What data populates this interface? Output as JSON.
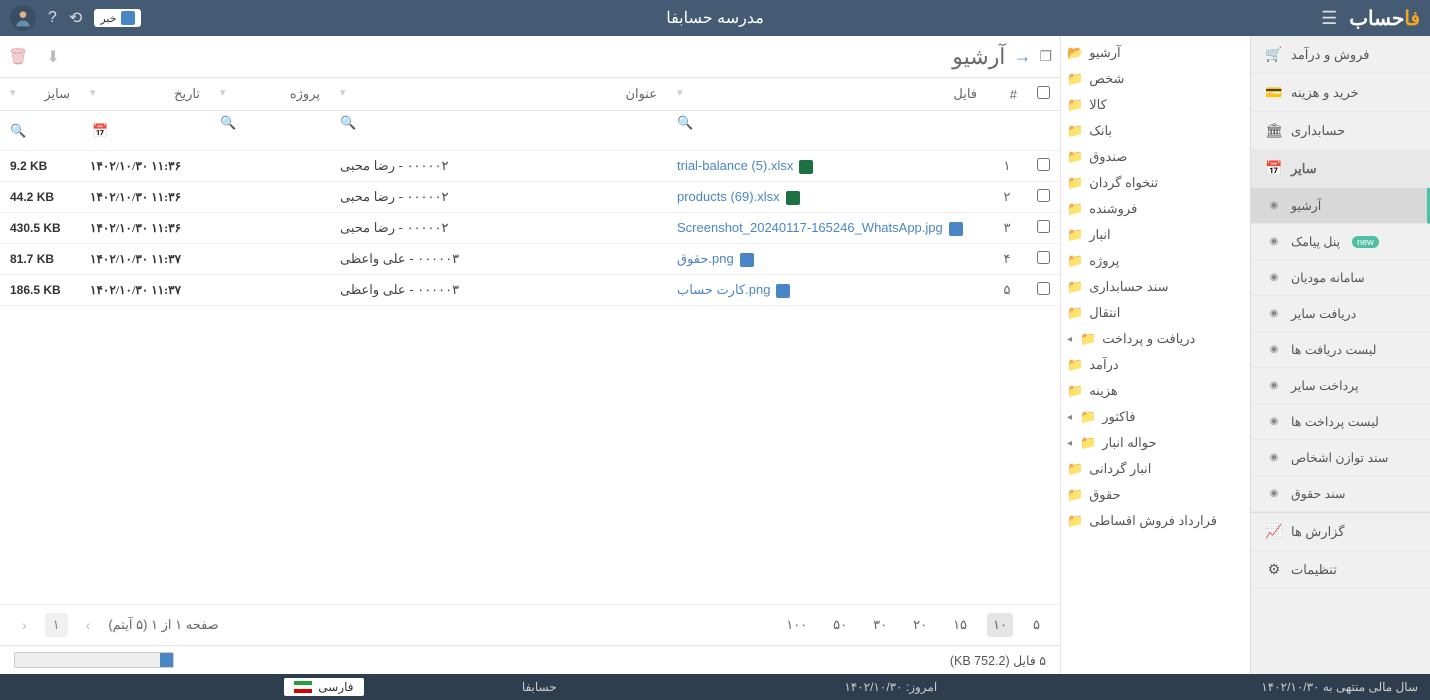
{
  "header": {
    "app_title": "مدرسه حسابفا",
    "logo_text": "حساب",
    "logo_accent": "فا",
    "khabar_label": "خبر"
  },
  "main_sidebar": {
    "items": [
      {
        "label": "فروش و درآمد",
        "icon": "🛒"
      },
      {
        "label": "خرید و هزینه",
        "icon": "💳"
      },
      {
        "label": "حسابداری",
        "icon": "🏛"
      }
    ],
    "section_head": {
      "label": "سایر",
      "icon": "📅"
    },
    "subs": [
      {
        "label": "آرشیو",
        "active": true
      },
      {
        "label": "پنل پیامک",
        "badge": "new"
      },
      {
        "label": "سامانه مودیان"
      },
      {
        "label": "دریافت سایر"
      },
      {
        "label": "لیست دریافت ها"
      },
      {
        "label": "پرداخت سایر"
      },
      {
        "label": "لیست پرداخت ها"
      },
      {
        "label": "سند توازن اشخاص"
      },
      {
        "label": "سند حقوق"
      }
    ],
    "bottom": [
      {
        "label": "گزارش ها",
        "icon": "📈"
      },
      {
        "label": "تنظیمات",
        "icon": "⚙"
      }
    ]
  },
  "tree": {
    "root": "آرشیو",
    "items": [
      "شخص",
      "کالا",
      "بانک",
      "صندوق",
      "تنخواه گردان",
      "فروشنده",
      "انبار",
      "پروژه",
      "سند حسابداری",
      "انتقال",
      "دریافت و پرداخت",
      "درآمد",
      "هزینه",
      "فاکتور",
      "حواله انبار",
      "انبار گردانی",
      "حقوق",
      "قرارداد فروش اقساطی"
    ],
    "caret_items": [
      "دریافت و پرداخت",
      "فاکتور",
      "حواله انبار"
    ]
  },
  "page": {
    "title": "آرشیو"
  },
  "table": {
    "headers": {
      "num": "#",
      "file": "فایل",
      "title": "عنوان",
      "project": "پروژه",
      "date": "تاریخ",
      "size": "سایز"
    },
    "rows": [
      {
        "n": "۱",
        "file": "trial-balance (5).xlsx",
        "ft": "xls",
        "title": "۰۰۰۰۰۲ - رضا محبی",
        "proj": "",
        "date": "۱۴۰۲/۱۰/۳۰ ۱۱:۳۶",
        "size": "9.2 KB"
      },
      {
        "n": "۲",
        "file": "products (69).xlsx",
        "ft": "xls",
        "title": "۰۰۰۰۰۲ - رضا محبی",
        "proj": "",
        "date": "۱۴۰۲/۱۰/۳۰ ۱۱:۳۶",
        "size": "44.2 KB"
      },
      {
        "n": "۳",
        "file": "Screenshot_20240117-165246_WhatsApp.jpg",
        "ft": "img",
        "title": "۰۰۰۰۰۲ - رضا محبی",
        "proj": "",
        "date": "۱۴۰۲/۱۰/۳۰ ۱۱:۳۶",
        "size": "430.5 KB"
      },
      {
        "n": "۴",
        "file": "حقوق.png",
        "ft": "img",
        "title": "۰۰۰۰۰۳ - علی واعظی",
        "proj": "",
        "date": "۱۴۰۲/۱۰/۳۰ ۱۱:۳۷",
        "size": "81.7 KB"
      },
      {
        "n": "۵",
        "file": "کارت حساب.png",
        "ft": "img",
        "title": "۰۰۰۰۰۳ - علی واعظی",
        "proj": "",
        "date": "۱۴۰۲/۱۰/۳۰ ۱۱:۳۷",
        "size": "186.5 KB"
      }
    ]
  },
  "pager": {
    "sizes": [
      "۵",
      "۱۰",
      "۱۵",
      "۲۰",
      "۳۰",
      "۵۰",
      "۱۰۰"
    ],
    "active_size": "۱۰",
    "current_page": "۱",
    "info": "صفحه ۱ از ۱ (۵ آیتم)"
  },
  "summary": {
    "text": "۵ فایل (752.2 KB)"
  },
  "footer": {
    "fiscal": "سال مالی منتهی به ۱۴۰۲/۱۰/۳۰",
    "today": "امروز: ۱۴۰۲/۱۰/۳۰",
    "brand": "حسابفا",
    "lang": "فارسی"
  }
}
